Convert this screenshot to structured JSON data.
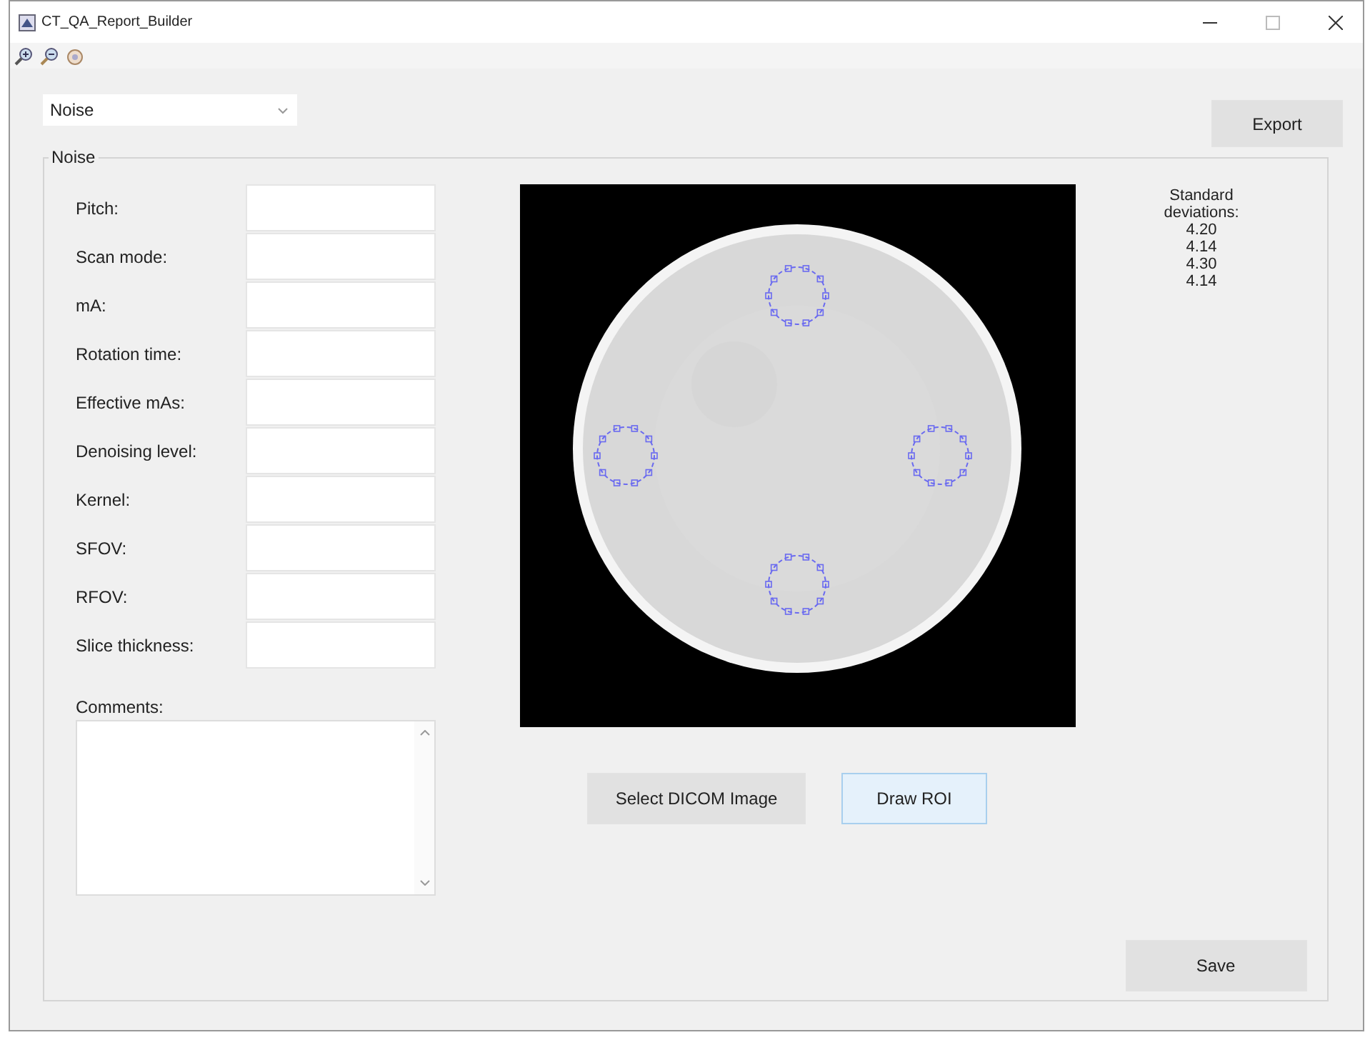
{
  "window": {
    "title": "CT_QA_Report_Builder"
  },
  "toolbar": {
    "tools": [
      {
        "kind": "zoom-in"
      },
      {
        "kind": "zoom-out"
      },
      {
        "kind": "pan"
      }
    ]
  },
  "test_selector": {
    "value": "Noise"
  },
  "export_button": "Export",
  "panel": {
    "title": "Noise",
    "fields": [
      {
        "label": "Pitch:"
      },
      {
        "label": "Scan mode:"
      },
      {
        "label": "mA:"
      },
      {
        "label": "Rotation time:"
      },
      {
        "label": "Effective mAs:"
      },
      {
        "label": "Denoising level:"
      },
      {
        "label": "Kernel:"
      },
      {
        "label": "SFOV:"
      },
      {
        "label": "RFOV:"
      },
      {
        "label": "Slice thickness:"
      }
    ],
    "comments_label": "Comments:",
    "select_button": "Select DICOM Image",
    "draw_button": {
      "label": "Draw ROI",
      "selected": true
    },
    "stats": {
      "label": "Standard deviations:",
      "values": [
        "4.20",
        "4.14",
        "4.30",
        "4.14"
      ]
    },
    "save_button": "Save"
  }
}
